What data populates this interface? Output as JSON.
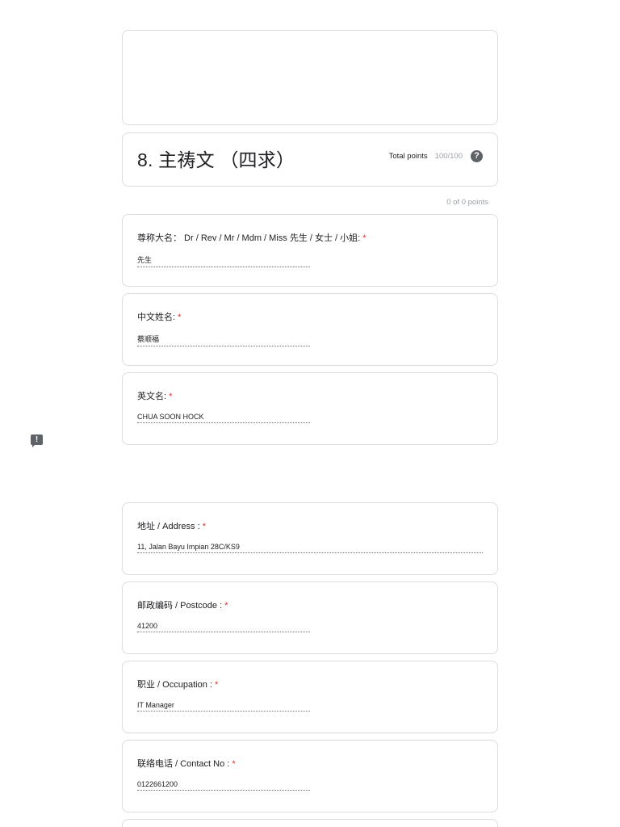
{
  "section": {
    "title": "8. 主祷文 （四求）",
    "total_label": "Total points",
    "total_value": "100/100",
    "help_glyph": "?",
    "section_points": "0 of 0 points"
  },
  "required_mark": "*",
  "questions": [
    {
      "label": "尊称大名： Dr / Rev / Mr / Mdm / Miss 先生 / 女士 / 小姐: ",
      "answer": "先生"
    },
    {
      "label": "中文姓名:  ",
      "answer": "蔡顺福"
    },
    {
      "label": "英文名:  ",
      "answer": "CHUA SOON HOCK"
    },
    {
      "label": "地址 / Address  :  ",
      "answer": "11, Jalan Bayu Impian 28C/KS9"
    },
    {
      "label": " 邮政编码 / Postcode : ",
      "answer": "41200"
    },
    {
      "label": "职业 / Occupation  : ",
      "answer": "IT Manager"
    },
    {
      "label": "联络电话 / Contact No : ",
      "answer": "0122661200"
    }
  ],
  "feedback": {
    "icon": "report-problem-icon",
    "glyph": "!"
  }
}
